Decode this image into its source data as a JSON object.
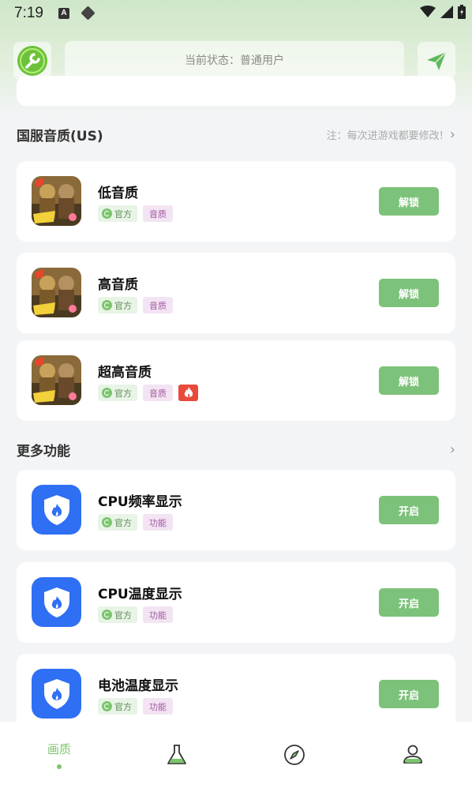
{
  "statusbar": {
    "time": "7:19",
    "a_badge": "A"
  },
  "header": {
    "status_text": "当前状态：普通用户"
  },
  "sections": {
    "quality": {
      "title": "国服音质(US)",
      "note": "注：每次进游戏都要修改!"
    },
    "more": {
      "title": "更多功能"
    }
  },
  "quality_items": [
    {
      "title": "低音质",
      "tag_official": "官方",
      "tag_kind": "音质",
      "button": "解锁",
      "hot": false
    },
    {
      "title": "高音质",
      "tag_official": "官方",
      "tag_kind": "音质",
      "button": "解锁",
      "hot": false
    },
    {
      "title": "超高音质",
      "tag_official": "官方",
      "tag_kind": "音质",
      "button": "解锁",
      "hot": true
    }
  ],
  "feature_items": [
    {
      "title": "CPU频率显示",
      "tag_official": "官方",
      "tag_kind": "功能",
      "button": "开启"
    },
    {
      "title": "CPU温度显示",
      "tag_official": "官方",
      "tag_kind": "功能",
      "button": "开启"
    },
    {
      "title": "电池温度显示",
      "tag_official": "官方",
      "tag_kind": "功能",
      "button": "开启"
    }
  ],
  "bottom_nav": {
    "active_label": "画质"
  },
  "colors": {
    "accent_green": "#7dc27a",
    "brand_blue": "#2f6ff4",
    "hot_red": "#e84b3c"
  },
  "icons": [
    "wrench-icon",
    "send-icon",
    "flask-icon",
    "compass-icon",
    "user-icon",
    "shield-flame-icon",
    "fire-icon",
    "chevron-right-icon"
  ]
}
